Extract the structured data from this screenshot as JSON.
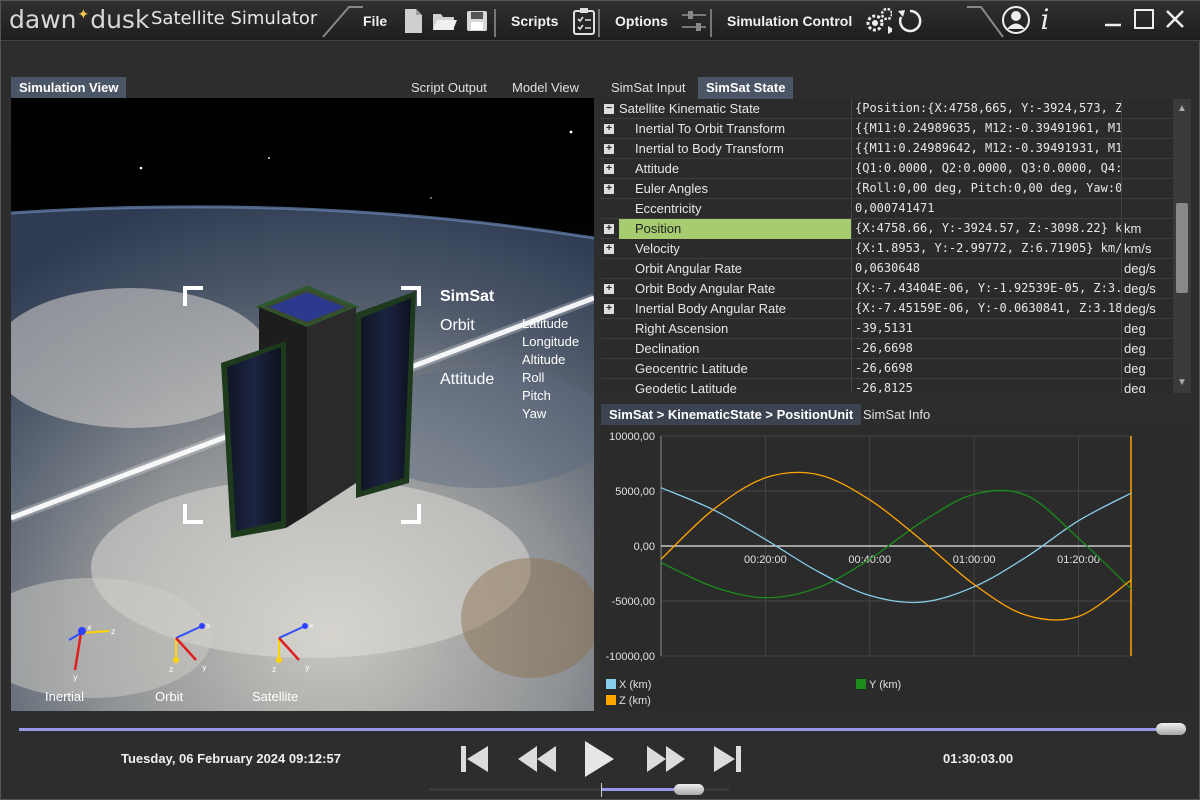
{
  "app": {
    "logo_left": "dawn",
    "logo_right": "dusk",
    "title": "Satellite Simulator"
  },
  "toolbar": {
    "file_label": "File",
    "scripts_label": "Scripts",
    "options_label": "Options",
    "sim_control_label": "Simulation Control",
    "info_label": "i"
  },
  "tabs": {
    "simulation_view": "Simulation View",
    "script_output": "Script Output",
    "model_view": "Model View",
    "simsat_input": "SimSat Input",
    "simsat_state": "SimSat State"
  },
  "overlay": {
    "sat_name": "SimSat",
    "orbit_label": "Orbit",
    "attitude_label": "Attitude",
    "orbit_fields": [
      "Latitude",
      "Longitude",
      "Altitude"
    ],
    "attitude_fields": [
      "Roll",
      "Pitch",
      "Yaw"
    ],
    "frames": [
      "Inertial",
      "Orbit",
      "Satellite"
    ]
  },
  "state_rows": [
    {
      "name": "Satellite Kinematic State",
      "value": "{Position:{X:4758,665, Y:-3924,573, Z",
      "unit": "",
      "indent": 0,
      "expander": "minus",
      "selected": false
    },
    {
      "name": "Inertial To Orbit Transform",
      "value": "{{M11:0.24989635, M12:-0.39491961, M1",
      "unit": "",
      "indent": 1,
      "expander": "plus",
      "selected": false
    },
    {
      "name": "Inertial to Body Transform",
      "value": "{{M11:0.24989642, M12:-0.39491931, M1",
      "unit": "",
      "indent": 1,
      "expander": "plus",
      "selected": false
    },
    {
      "name": "Attitude",
      "value": "{Q1:0.0000, Q2:0.0000, Q3:0.0000, Q4:",
      "unit": "",
      "indent": 1,
      "expander": "plus",
      "selected": false
    },
    {
      "name": "Euler Angles",
      "value": "{Roll:0,00 deg, Pitch:0,00 deg, Yaw:0",
      "unit": "",
      "indent": 1,
      "expander": "plus",
      "selected": false
    },
    {
      "name": "Eccentricity",
      "value": "0,000741471",
      "unit": "",
      "indent": 1,
      "expander": "",
      "selected": false
    },
    {
      "name": "Position",
      "value": "{X:4758.66, Y:-3924.57, Z:-3098.22} k",
      "unit": "km",
      "indent": 1,
      "expander": "plus",
      "selected": true
    },
    {
      "name": "Velocity",
      "value": "{X:1.8953, Y:-2.99772, Z:6.71905} km/",
      "unit": "km/s",
      "indent": 1,
      "expander": "plus",
      "selected": false
    },
    {
      "name": "Orbit Angular Rate",
      "value": "0,0630648",
      "unit": "deg/s",
      "indent": 1,
      "expander": "",
      "selected": false
    },
    {
      "name": "Orbit Body Angular Rate",
      "value": "{X:-7.43404E-06, Y:-1.92539E-05, Z:3.",
      "unit": "deg/s",
      "indent": 1,
      "expander": "plus",
      "selected": false
    },
    {
      "name": "Inertial Body Angular Rate",
      "value": "{X:-7.45159E-06, Y:-0.0630841, Z:3.18",
      "unit": "deg/s",
      "indent": 1,
      "expander": "plus",
      "selected": false
    },
    {
      "name": "Right Ascension",
      "value": "-39,5131",
      "unit": "deg",
      "indent": 1,
      "expander": "",
      "selected": false
    },
    {
      "name": "Declination",
      "value": "-26,6698",
      "unit": "deg",
      "indent": 1,
      "expander": "",
      "selected": false
    },
    {
      "name": "Geocentric Latitude",
      "value": "-26,6698",
      "unit": "deg",
      "indent": 1,
      "expander": "",
      "selected": false
    },
    {
      "name": "Geodetic Latitude",
      "value": "-26,8125",
      "unit": "deg",
      "indent": 1,
      "expander": "",
      "selected": false
    }
  ],
  "chart_tabs": {
    "active": "SimSat > KinematicState > PositionUnit",
    "other": "SimSat Info"
  },
  "chart_data": {
    "type": "line",
    "title": "",
    "xlabel": "",
    "ylabel": "",
    "xlim": [
      0,
      5403
    ],
    "ylim": [
      -10000,
      10000
    ],
    "y_ticks": [
      10000,
      5000,
      0,
      -5000,
      -10000
    ],
    "y_tick_labels": [
      "10000,00",
      "5000,00",
      "0,00",
      "-5000,00",
      "-10000,00"
    ],
    "x_ticks": [
      1200,
      2400,
      3600,
      4800
    ],
    "x_tick_labels": [
      "00:20:00",
      "00:40:00",
      "01:00:00",
      "01:20:00"
    ],
    "grid": true,
    "legend": "bottom",
    "series": [
      {
        "name": "X (km)",
        "color": "#87ceeb",
        "x": [
          0,
          600,
          1200,
          1800,
          2400,
          3000,
          3600,
          4200,
          4800,
          5403
        ],
        "values": [
          5300,
          3300,
          600,
          -2300,
          -4500,
          -5100,
          -3700,
          -1000,
          2300,
          4800
        ]
      },
      {
        "name": "Y (km)",
        "color": "#1a8c1a",
        "x": [
          0,
          600,
          1200,
          1800,
          2400,
          3000,
          3600,
          4200,
          4800,
          5403
        ],
        "values": [
          -1500,
          -3700,
          -4700,
          -3800,
          -1200,
          2200,
          4700,
          4600,
          700,
          -3900
        ]
      },
      {
        "name": "Z (km)",
        "color": "#ffa500",
        "x": [
          0,
          600,
          1200,
          1800,
          2400,
          3000,
          3600,
          4200,
          4800,
          5403
        ],
        "values": [
          -1200,
          3300,
          6200,
          6500,
          4200,
          500,
          -3500,
          -6300,
          -6400,
          -3100
        ]
      }
    ]
  },
  "playback": {
    "datetime": "Tuesday, 06 February 2024 09:12:57",
    "elapsed": "01:30:03.00",
    "timeline_progress": 0.99
  },
  "colors": {
    "accent": "#9898e8",
    "selected_row": "#a7cc6f",
    "tab_active": "#4a5566"
  }
}
